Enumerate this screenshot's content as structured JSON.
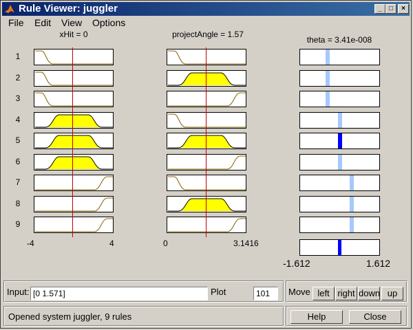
{
  "window": {
    "title": "Rule Viewer: juggler"
  },
  "menu": [
    "File",
    "Edit",
    "View",
    "Options"
  ],
  "inputs": [
    {
      "name": "xHit",
      "label": "xHit = 0",
      "value": 0,
      "range": [
        -4,
        4
      ],
      "range_labels": [
        "-4",
        "4"
      ]
    },
    {
      "name": "projectAngle",
      "label": "projectAngle = 1.57",
      "value": 1.57,
      "range": [
        0,
        3.1416
      ],
      "range_labels": [
        "0",
        "3.1416"
      ]
    }
  ],
  "output": {
    "name": "theta",
    "label": "theta = 3.41e-008",
    "range_labels": [
      "-1.612",
      "1.612"
    ]
  },
  "rules": [
    "1",
    "2",
    "3",
    "4",
    "5",
    "6",
    "7",
    "8",
    "9"
  ],
  "rule_mfs": {
    "xHit": [
      "left",
      "left",
      "left",
      "center",
      "center",
      "center",
      "right",
      "right",
      "right"
    ],
    "projectAngle": [
      "left",
      "center",
      "right",
      "left",
      "center",
      "right",
      "left",
      "center",
      "right"
    ]
  },
  "rule_firing": {
    "xHit": [
      0,
      0,
      0,
      1,
      1,
      1,
      0,
      0,
      0
    ],
    "projectAngle": [
      0,
      1,
      0,
      0,
      1,
      0,
      0,
      1,
      0
    ]
  },
  "output_bars": {
    "positions": [
      0.35,
      0.35,
      0.35,
      0.5,
      0.5,
      0.5,
      0.65,
      0.65,
      0.65
    ],
    "fired": [
      0,
      0,
      0,
      0,
      1,
      0,
      0,
      0,
      0
    ],
    "aggregate_position": 0.5
  },
  "colors": {
    "fill": "#ffff00",
    "redline": "#c00000",
    "bar_light": "#a6c8ff",
    "bar_dark": "#0000ff",
    "title_bar": "#0a246a"
  },
  "controls": {
    "input_label": "Input:",
    "input_value": "[0 1.571]",
    "plot_label": "Plot",
    "plot_value": "101",
    "move_label": "Move",
    "move_buttons": [
      "left",
      "right",
      "down",
      "up"
    ],
    "status": "Opened system juggler, 9 rules",
    "help_label": "Help",
    "close_label": "Close"
  },
  "icons": {
    "app": "matlab-logo-icon",
    "minimize": "minimize-icon",
    "maximize": "maximize-icon",
    "close": "close-icon"
  }
}
